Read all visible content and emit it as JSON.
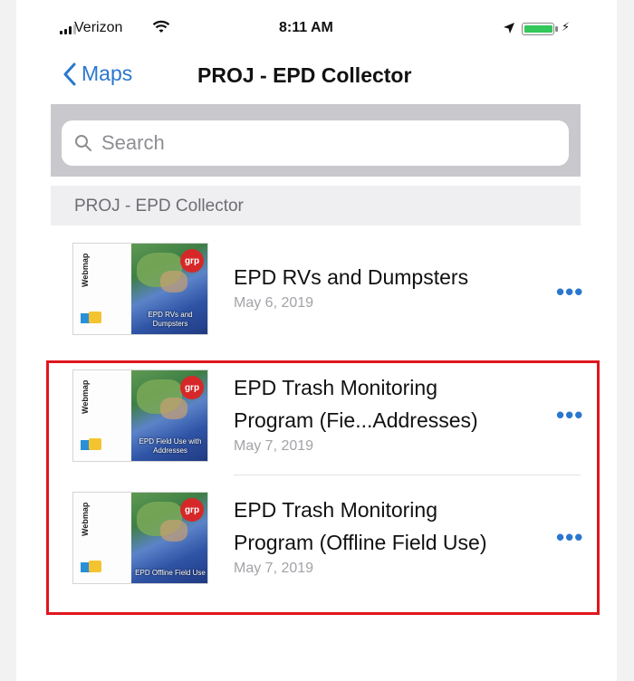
{
  "status_bar": {
    "carrier": "Verizon",
    "time": "8:11 AM",
    "battery_color": "#34c759"
  },
  "nav": {
    "back_label": "Maps",
    "title": "PROJ - EPD Collector"
  },
  "search": {
    "placeholder": "Search",
    "value": ""
  },
  "section_header": "PROJ - EPD Collector",
  "thumbnail": {
    "side_label": "Webmap",
    "badge": "grp"
  },
  "items": [
    {
      "title_line1": "EPD RVs and Dumpsters",
      "title_line2": "",
      "date": "May 6, 2019",
      "thumb_caption": "EPD RVs and Dumpsters",
      "more": "•••"
    },
    {
      "title_line1": "EPD Trash Monitoring",
      "title_line2": "Program (Fie...Addresses)",
      "date": "May 7, 2019",
      "thumb_caption": "EPD Field Use with Addresses",
      "more": "•••"
    },
    {
      "title_line1": "EPD Trash Monitoring",
      "title_line2": "Program (Offline Field Use)",
      "date": "May 7, 2019",
      "thumb_caption": "EPD Offline Field Use",
      "more": "•••"
    }
  ],
  "colors": {
    "accent": "#2a77ce",
    "highlight": "#e0161e"
  }
}
